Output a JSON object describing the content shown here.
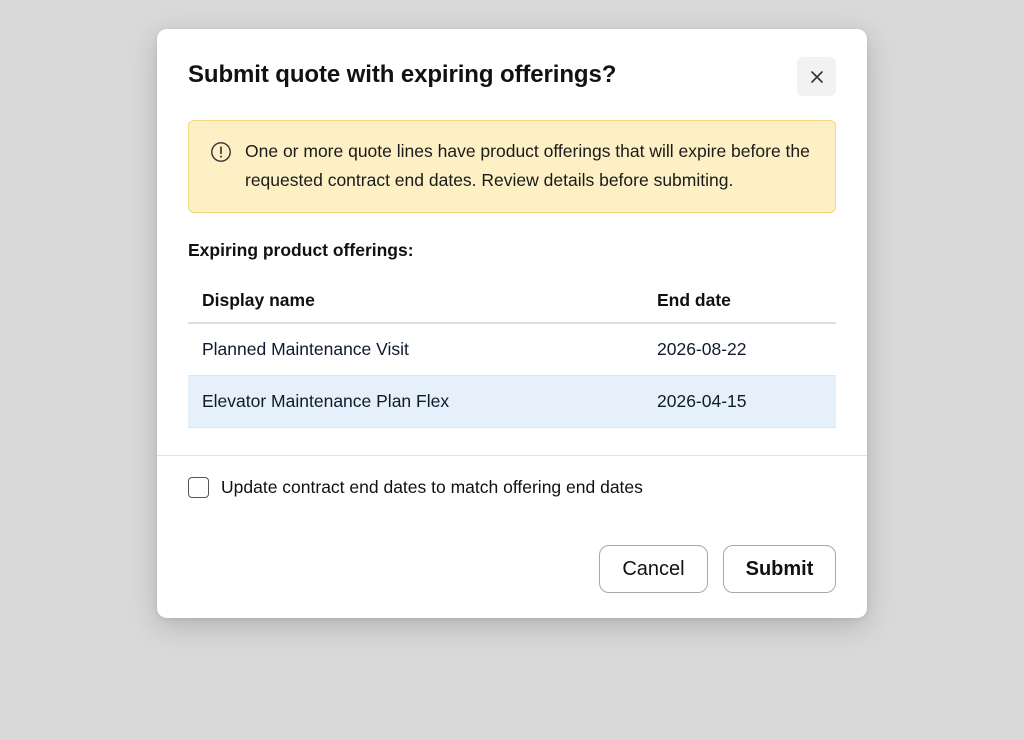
{
  "dialog": {
    "title": "Submit quote with expiring offerings?",
    "close_icon": "close-icon"
  },
  "alert": {
    "icon": "info-circle-icon",
    "message": "One or more quote lines have product offerings that will expire before the requested contract end dates. Review details before submiting."
  },
  "section": {
    "heading": "Expiring product offerings:"
  },
  "table": {
    "columns": [
      "Display name",
      "End date"
    ],
    "rows": [
      {
        "name": "Planned Maintenance Visit",
        "end_date": "2026-08-22"
      },
      {
        "name": "Elevator Maintenance Plan Flex",
        "end_date": "2026-04-15"
      }
    ]
  },
  "option": {
    "label": "Update contract end dates to match offering end dates",
    "checked": false
  },
  "footer": {
    "cancel_label": "Cancel",
    "submit_label": "Submit"
  }
}
